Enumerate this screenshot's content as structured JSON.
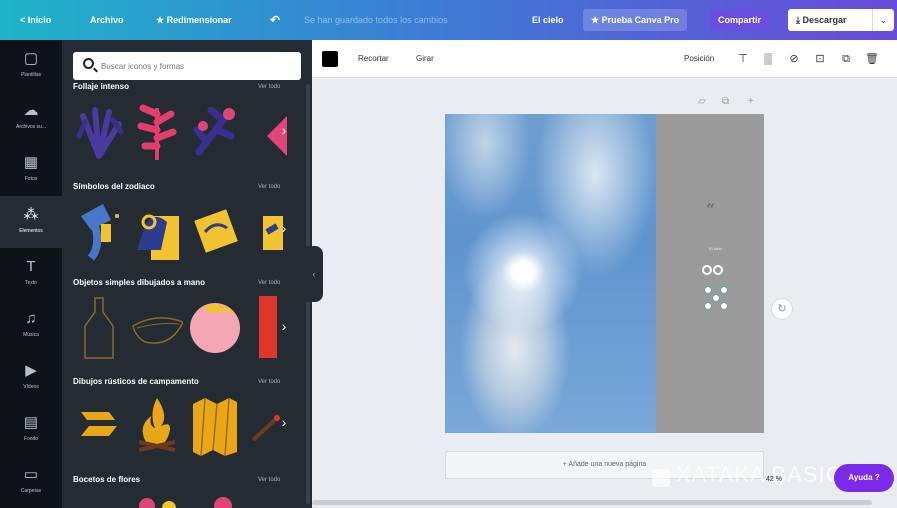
{
  "topbar": {
    "home": "< Inicio",
    "file": "Archivo",
    "resize": "★ Redimensionar",
    "undo_icon": "undo-icon",
    "status": "Se han guardado todos los cambios",
    "doc_title": "El cielo",
    "pro": "★ Prueba Canva Pro",
    "share": "Compartir",
    "download": "⤓  Descargar",
    "download_caret": "⌄"
  },
  "rail": [
    {
      "icon": "▢",
      "label": "Plantillas"
    },
    {
      "icon": "☁",
      "label": "Archivos su..."
    },
    {
      "icon": "▦",
      "label": "Fotos"
    },
    {
      "icon": "⁂",
      "label": "Elementos",
      "active": true
    },
    {
      "icon": "T",
      "label": "Texto"
    },
    {
      "icon": "♫",
      "label": "Música"
    },
    {
      "icon": "▶",
      "label": "Vídeos"
    },
    {
      "icon": "▤",
      "label": "Fondo"
    },
    {
      "icon": "▭",
      "label": "Carpetas"
    }
  ],
  "panel": {
    "search_placeholder": "Buscar iconos y formas",
    "see_all": "Ver todo",
    "sections": [
      {
        "title": "Follaje intenso"
      },
      {
        "title": "Símbolos del zodiaco"
      },
      {
        "title": "Objetos simples dibujados a mano"
      },
      {
        "title": "Dibujos rústicos de campamento"
      },
      {
        "title": "Bocetos de flores"
      }
    ]
  },
  "toolbar": {
    "crop": "Recortar",
    "flip": "Girar",
    "position": "Posición",
    "swatch_color": "#000000"
  },
  "canvas": {
    "page_small_text": "El cielo",
    "add_page": "+ Añade una nueva página",
    "watermark": "XATAKA BASICS",
    "zoom": "42 %",
    "help": "Ayuda ?"
  },
  "colors": {
    "topbar_start": "#1fb3c8",
    "topbar_end": "#6a4ad9",
    "rail_bg": "#0e1318",
    "panel_bg": "#252b33",
    "share_bg": "#6b4ee0",
    "help_bg": "#7d2ae8"
  }
}
